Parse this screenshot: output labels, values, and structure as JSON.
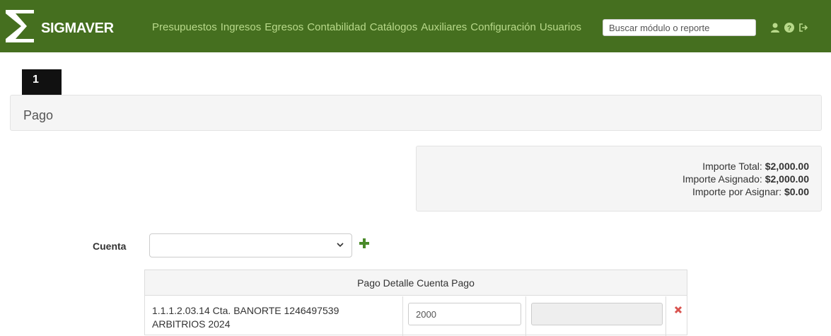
{
  "header": {
    "brand": "SIGMAVER",
    "menu": [
      "Presupuestos",
      "Ingresos",
      "Egresos",
      "Contabilidad",
      "Catálogos",
      "Auxiliares",
      "Configuración",
      "Usuarios"
    ],
    "search_placeholder": "Buscar módulo o reporte",
    "icons": [
      "user-icon",
      "help-icon",
      "logout-icon"
    ],
    "color": "#456f1f",
    "menu_color": "#b8d98a"
  },
  "step": {
    "number": "1"
  },
  "panel": {
    "title": "Pago"
  },
  "summary": {
    "total_label": "Importe Total:",
    "total_value": "$2,000.00",
    "assigned_label": "Importe Asignado:",
    "assigned_value": "$2,000.00",
    "pending_label": "Importe por Asignar:",
    "pending_value": "$0.00"
  },
  "form": {
    "cuenta_label": "Cuenta",
    "cuenta_value": ""
  },
  "table": {
    "header": "Pago Detalle Cuenta Pago",
    "rows": [
      {
        "account_line1": "1.1.1.2.03.14 Cta. BANORTE 1246497539",
        "account_line2": "ARBITRIOS 2024",
        "amount": "2000",
        "extra": ""
      }
    ]
  }
}
